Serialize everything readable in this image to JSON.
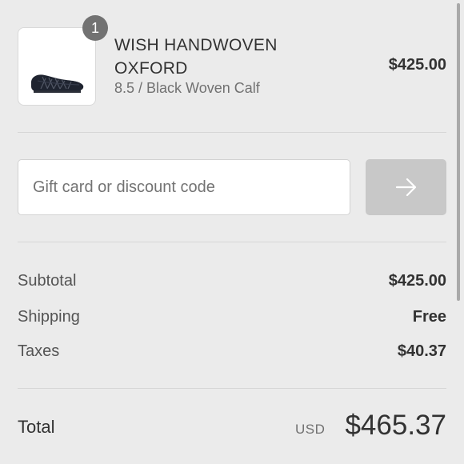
{
  "product": {
    "quantity": "1",
    "name_line1": "WISH HANDWOVEN",
    "name_line2": "OXFORD",
    "variant": "8.5 / Black Woven Calf",
    "price": "$425.00",
    "image_icon": "shoe-icon"
  },
  "discount": {
    "placeholder": "Gift card or discount code",
    "value": "",
    "apply_icon": "arrow-right-icon"
  },
  "totals": {
    "subtotal_label": "Subtotal",
    "subtotal_value": "$425.00",
    "shipping_label": "Shipping",
    "shipping_value": "Free",
    "taxes_label": "Taxes",
    "taxes_value": "$40.37",
    "total_label": "Total",
    "currency": "USD",
    "total_value": "$465.37"
  },
  "colors": {
    "background": "#ebebeb",
    "text": "#323232",
    "muted_text": "#717171",
    "badge": "#727272",
    "button_disabled": "#c8c8c8"
  }
}
